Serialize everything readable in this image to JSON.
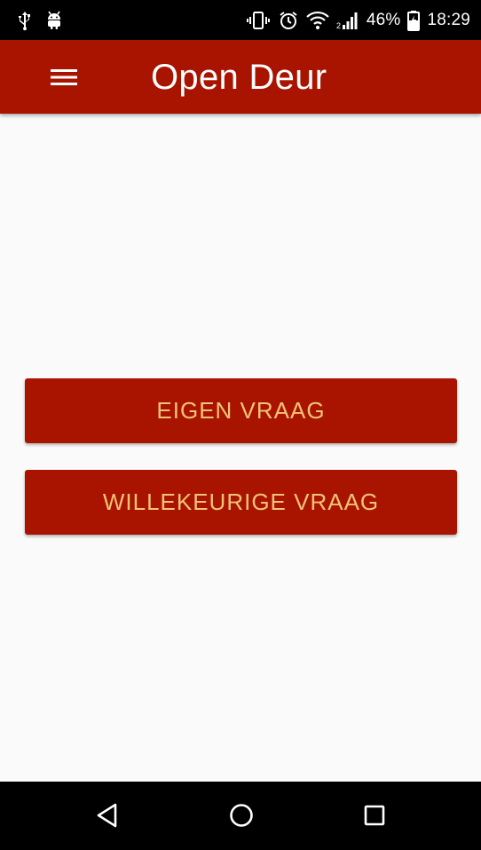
{
  "status_bar": {
    "battery_percent": "46%",
    "time": "18:29",
    "icons": [
      "usb-icon",
      "android-debug-icon",
      "vibrate-icon",
      "alarm-icon",
      "wifi-icon",
      "signal-icon",
      "battery-charging-icon"
    ]
  },
  "app_bar": {
    "title": "Open Deur",
    "menu_icon": "hamburger-menu-icon"
  },
  "main": {
    "buttons": [
      {
        "label": "EIGEN VRAAG"
      },
      {
        "label": "WILLEKEURIGE VRAAG"
      }
    ]
  },
  "nav_bar": {
    "icons": [
      "back-icon",
      "home-icon",
      "recents-icon"
    ]
  },
  "colors": {
    "primary": "#a81400",
    "button_text": "#f2c277",
    "background": "#fafafa",
    "status_bar": "#000000"
  }
}
